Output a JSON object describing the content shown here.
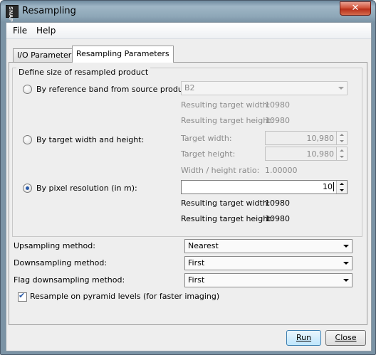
{
  "window": {
    "title": "Resampling",
    "app_icon_text": "SNAP",
    "close_glyph": "✕"
  },
  "menu": {
    "file": "File",
    "help": "Help"
  },
  "tabs": [
    {
      "label": "I/O Parameters"
    },
    {
      "label": "Resampling Parameters"
    }
  ],
  "group": {
    "title": "Define size of resampled product",
    "ref_band": {
      "label": "By reference band from source product:",
      "selected": false,
      "value": "B2",
      "width_label": "Resulting target width:",
      "width_value": "10980",
      "height_label": "Resulting target height:",
      "height_value": "10980"
    },
    "target_size": {
      "label": "By target width and height:",
      "selected": false,
      "width_label": "Target width:",
      "width_value": "10,980",
      "height_label": "Target height:",
      "height_value": "10,980",
      "ratio_label": "Width / height ratio:",
      "ratio_value": "1.00000"
    },
    "pixel_res": {
      "label": "By pixel resolution (in m):",
      "selected": true,
      "value": "10",
      "width_label": "Resulting target width:",
      "width_value": "10980",
      "height_label": "Resulting target height:",
      "height_value": "10980"
    }
  },
  "methods": {
    "upsampling_label": "Upsampling method:",
    "upsampling_value": "Nearest",
    "downsampling_label": "Downsampling method:",
    "downsampling_value": "First",
    "flag_label": "Flag downsampling method:",
    "flag_value": "First"
  },
  "pyramid": {
    "label": "Resample on pyramid levels (for faster imaging)",
    "checked": true
  },
  "buttons": {
    "run": "Run",
    "close": "Close"
  },
  "icons": {
    "radio": "radio-button",
    "check": "✔",
    "dropdown": "chevron-down-icon"
  }
}
